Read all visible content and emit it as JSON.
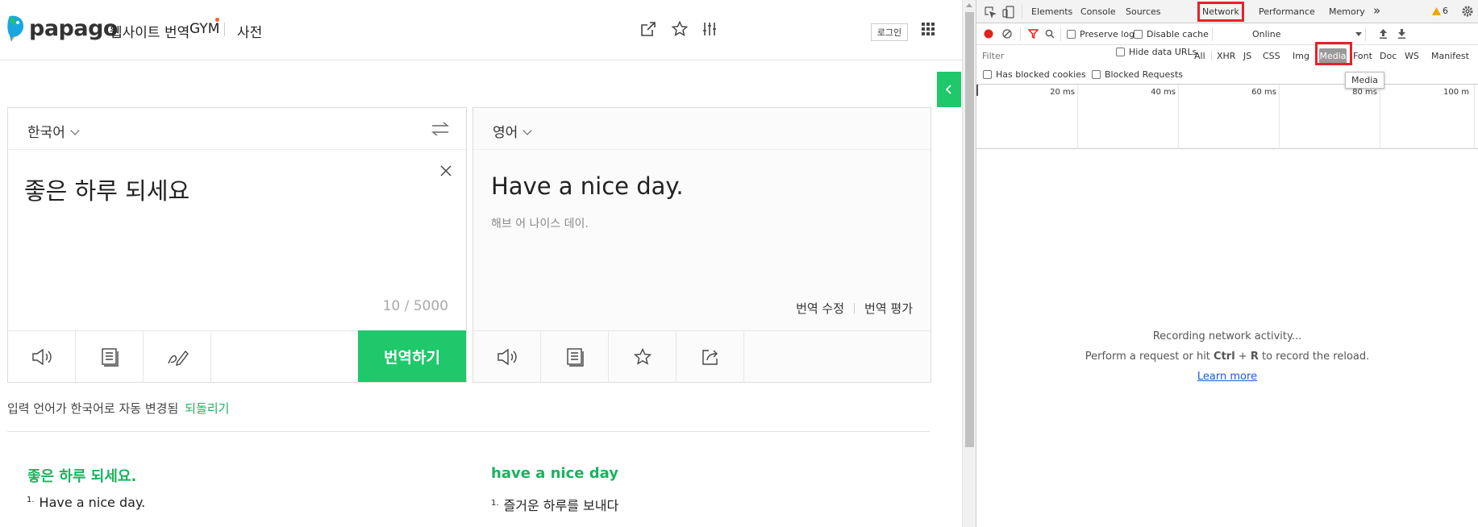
{
  "header": {
    "logo_text": "papago",
    "nav": [
      "웹사이트 번역",
      "GYM",
      "사전"
    ],
    "login_label": "로그인",
    "icons": [
      "share-window-icon",
      "star-icon",
      "settings-sliders-icon",
      "apps-grid-icon"
    ]
  },
  "source": {
    "language": "한국어",
    "text": "좋은 하루 되세요",
    "counter": "10 / 5000",
    "translate_label": "번역하기",
    "icons": [
      "speaker-icon",
      "note-icon",
      "handwriting-icon"
    ]
  },
  "target": {
    "language": "영어",
    "text": "Have a nice day.",
    "pronunciation": "해브 어 나이스 데이.",
    "edit_label": "번역 수정",
    "rate_label": "번역 평가",
    "icons": [
      "speaker-icon",
      "note-icon",
      "star-icon",
      "share-icon"
    ]
  },
  "auto_note": {
    "text": "입력 언어가 한국어로 자동 변경됨",
    "undo_label": "되돌리기"
  },
  "dictionary": {
    "left_head": "좋은 하루 되세요.",
    "left_item_num": "1.",
    "left_item": "Have a nice day.",
    "right_head": "have a nice day",
    "right_item_num": "1.",
    "right_item": "즐거운 하루를 보내다"
  },
  "devtools": {
    "tabs": [
      "Elements",
      "Console",
      "Sources",
      "Network",
      "Performance",
      "Memory"
    ],
    "more_label": "»",
    "warning_count": "6",
    "toolbar": {
      "preserve_log": "Preserve log",
      "disable_cache": "Disable cache",
      "throttling": "Online"
    },
    "filter": {
      "placeholder": "Filter",
      "hide_data_urls": "Hide data URLs",
      "types": [
        "All",
        "XHR",
        "JS",
        "CSS",
        "Img",
        "Media",
        "Font",
        "Doc",
        "WS",
        "Manifest"
      ],
      "tooltip": "Media",
      "has_blocked_cookies": "Has blocked cookies",
      "blocked_requests": "Blocked Requests"
    },
    "timeline_ticks": [
      "20 ms",
      "40 ms",
      "60 ms",
      "80 ms",
      "100 m"
    ],
    "empty_state": {
      "line1": "Recording network activity...",
      "line2_pre": "Perform a request or hit ",
      "line2_key1": "Ctrl",
      "line2_plus": " + ",
      "line2_key2": "R",
      "line2_post": " to record the reload.",
      "learn_more": "Learn more"
    }
  },
  "colors": {
    "papago_green": "#1ec86b",
    "highlight_red": "#e8202a",
    "link_blue": "#1a5bd6"
  }
}
